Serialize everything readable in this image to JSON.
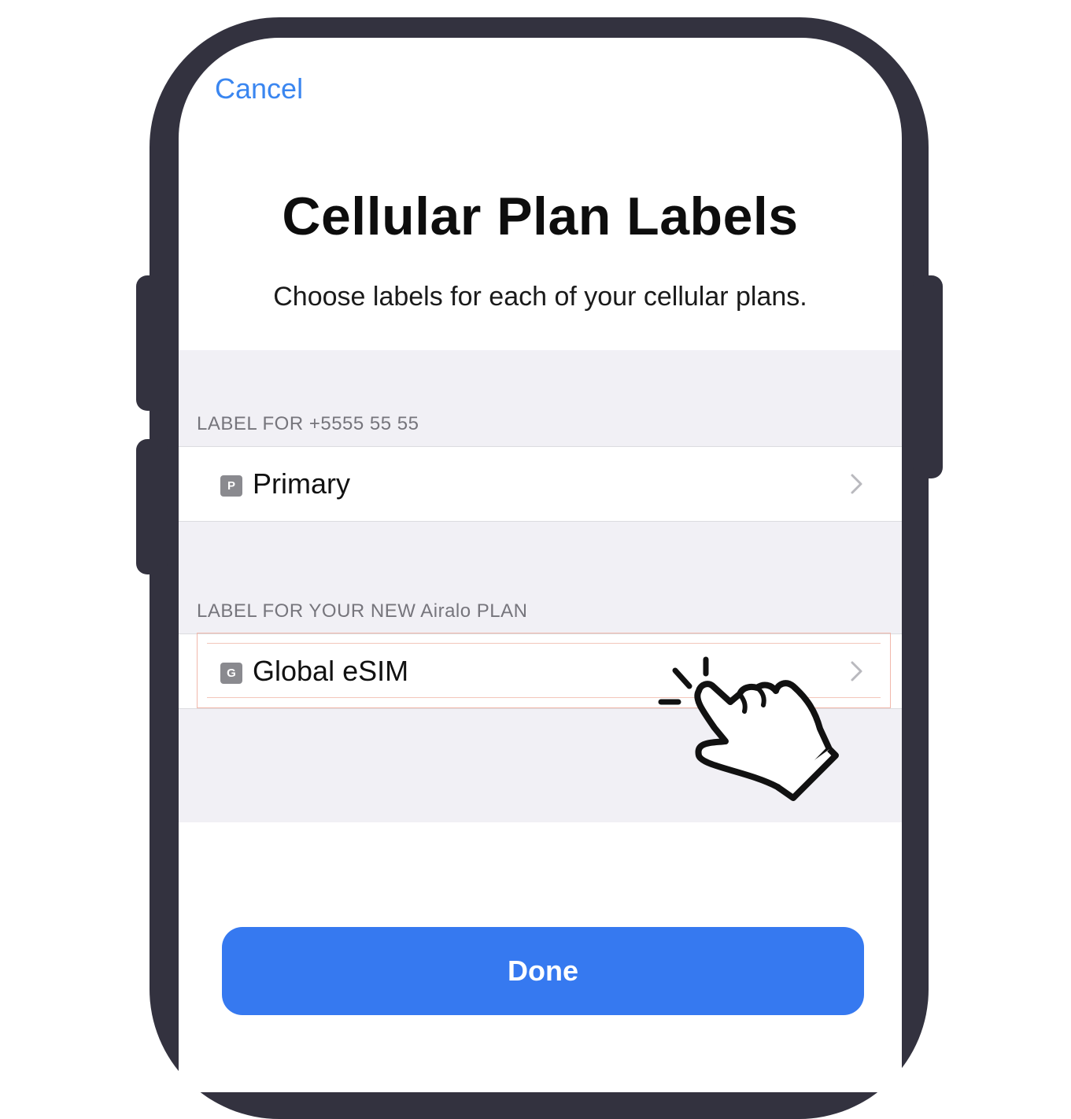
{
  "nav": {
    "cancel_label": "Cancel"
  },
  "header": {
    "title": "Cellular Plan Labels",
    "subtitle": "Choose labels for each of your cellular plans."
  },
  "sections": [
    {
      "header": "LABEL FOR +5555 55 55",
      "row": {
        "badge": "P",
        "label": "Primary"
      }
    },
    {
      "header": "LABEL FOR YOUR NEW Airalo PLAN",
      "row": {
        "badge": "G",
        "label": "Global eSIM"
      }
    }
  ],
  "footer": {
    "done_label": "Done"
  },
  "colors": {
    "accent": "#3679f0",
    "frame": "#33323f",
    "grouped_background": "#f1f0f5"
  },
  "icons": [
    "chevron-right-icon",
    "tap-hand-icon"
  ]
}
